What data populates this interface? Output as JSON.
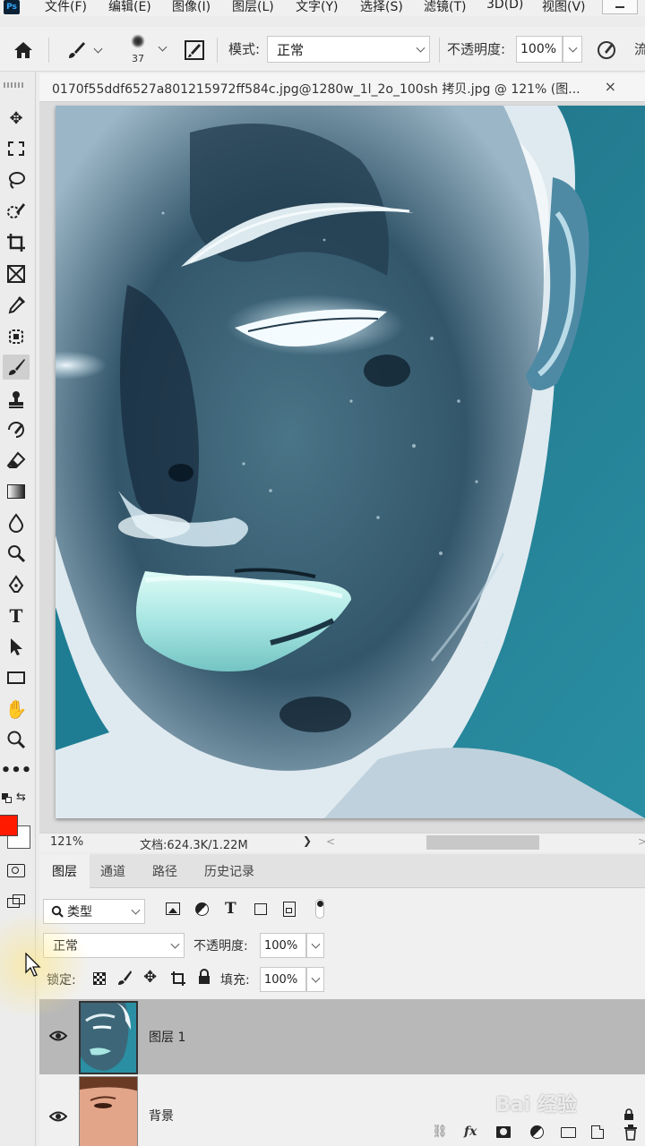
{
  "app": {
    "logo": "Ps"
  },
  "menu": {
    "items": [
      "文件(F)",
      "编辑(E)",
      "图像(I)",
      "图层(L)",
      "文字(Y)",
      "选择(S)",
      "滤镜(T)",
      "3D(D)",
      "视图(V)"
    ]
  },
  "options": {
    "brush_size": "37",
    "mode_label": "模式:",
    "mode_value": "正常",
    "opacity_label": "不透明度:",
    "opacity_value": "100%",
    "trailing_char": "流"
  },
  "document": {
    "tab_title": "0170f55ddf6527a801215972ff584c.jpg@1280w_1l_2o_100sh 拷贝.jpg @ 121% (图...",
    "close": "×"
  },
  "status": {
    "zoom": "121%",
    "doc_info": "文档:624.3K/1.22M",
    "arrow": "❯"
  },
  "layers_panel": {
    "tabs": [
      "图层",
      "通道",
      "路径",
      "历史记录"
    ],
    "filter_label": "类型",
    "blend_mode": "正常",
    "opacity_label": "不透明度:",
    "opacity_value": "100%",
    "lock_label": "锁定:",
    "fill_label": "填充:",
    "fill_value": "100%",
    "layers": [
      {
        "name": "图层 1",
        "selected": true
      },
      {
        "name": "背景",
        "selected": false
      }
    ]
  },
  "colors": {
    "foreground": "#ff1a00",
    "background": "#ffffff",
    "selected_layer": "#b8b8b8"
  },
  "watermark": "Bai 经验"
}
